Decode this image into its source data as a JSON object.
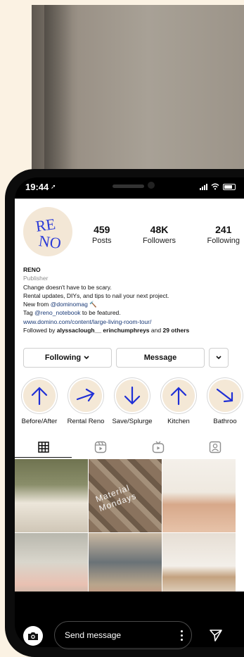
{
  "status": {
    "time": "19:44"
  },
  "profile": {
    "avatar_logo": "RENO",
    "stats": [
      {
        "num": "459",
        "label": "Posts"
      },
      {
        "num": "48K",
        "label": "Followers"
      },
      {
        "num": "241",
        "label": "Following"
      }
    ],
    "name": "RENO",
    "category": "Publisher",
    "bio_lines": [
      "Change doesn't have to be scary.",
      "Rental updates, DIYs, and tips to nail your next project."
    ],
    "new_from_prefix": "New from",
    "new_from_handle": "@dominomag",
    "tag_prefix": "Tag",
    "tag_handle": "@reno_notebook",
    "tag_suffix": "to be featured.",
    "website": "www.domino.com/content/large-living-room-tour/",
    "followed_by_prefix": "Followed by",
    "followed_by_names": "alyssaclough__ erinchumphreys",
    "followed_by_and": "and",
    "followed_by_others": "29 others"
  },
  "actions": {
    "following_label": "Following",
    "message_label": "Message"
  },
  "highlights": [
    {
      "label": "Before/After",
      "arrow": "arrow-up-icon"
    },
    {
      "label": "Rental Reno",
      "arrow": "arrow-right-icon"
    },
    {
      "label": "Save/Splurge",
      "arrow": "arrow-down-icon"
    },
    {
      "label": "Kitchen",
      "arrow": "arrow-up-icon"
    },
    {
      "label": "Bathroo",
      "arrow": "arrow-down-right-icon"
    }
  ],
  "grid": {
    "watermark": "Material Mondays"
  },
  "bottom": {
    "message_placeholder": "Send message"
  },
  "colors": {
    "highlight_arrow": "#1f2fd6",
    "link": "#1a3a77"
  }
}
